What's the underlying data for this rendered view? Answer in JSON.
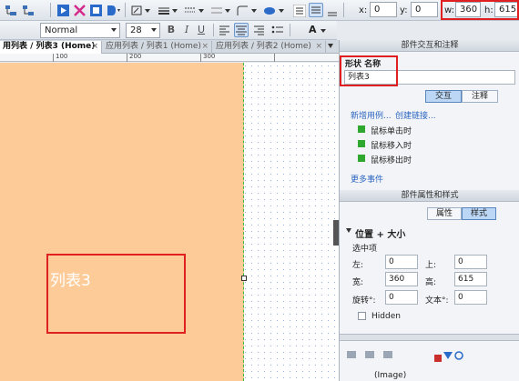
{
  "toolbar": {
    "font_name": "Normal",
    "font_size": "28",
    "x_label": "x:",
    "x_value": "0",
    "y_label": "y:",
    "y_value": "0",
    "w_label": "w:",
    "w_value": "360",
    "h_label": "h:",
    "h_value": "615",
    "bold": "B",
    "italic": "I",
    "underline": "U",
    "font_color_glyph": "A"
  },
  "tabs": [
    {
      "label": "用列表 / 列表3 (Home)",
      "active": true
    },
    {
      "label": "应用列表 / 列表1 (Home)",
      "active": false
    },
    {
      "label": "应用列表 / 列表2 (Home)",
      "active": false
    }
  ],
  "ruler": {
    "marks": [
      "100",
      "200",
      "300"
    ]
  },
  "canvas": {
    "shape_label": "列表3",
    "shape_color": "#fdcb98"
  },
  "panel": {
    "header": "部件交互和注释",
    "name_label": "形状 名称",
    "name_value": "列表3",
    "tab_interaction": "交互",
    "tab_notes": "注释",
    "link_new_case": "新增用例...",
    "link_create_link": "创建链接...",
    "events": [
      "鼠标单击时",
      "鼠标移入时",
      "鼠标移出时"
    ],
    "more_events": "更多事件",
    "props_header": "部件属性和样式",
    "tab_properties": "属性",
    "tab_style": "样式",
    "section_title": "位置 + 大小",
    "selected_label": "选中项",
    "left_label": "左:",
    "left_value": "0",
    "top_label": "上:",
    "top_value": "0",
    "width_label": "宽:",
    "width_value": "360",
    "height_label": "高:",
    "height_value": "615",
    "rotate_label": "旋转°:",
    "rotate_value": "0",
    "text_rot_label": "文本°:",
    "text_rot_value": "0",
    "hidden_label": "Hidden",
    "bottom_item": "(Image)"
  },
  "colors": {
    "highlight": "#e02020",
    "accent": "#2d66c2"
  }
}
